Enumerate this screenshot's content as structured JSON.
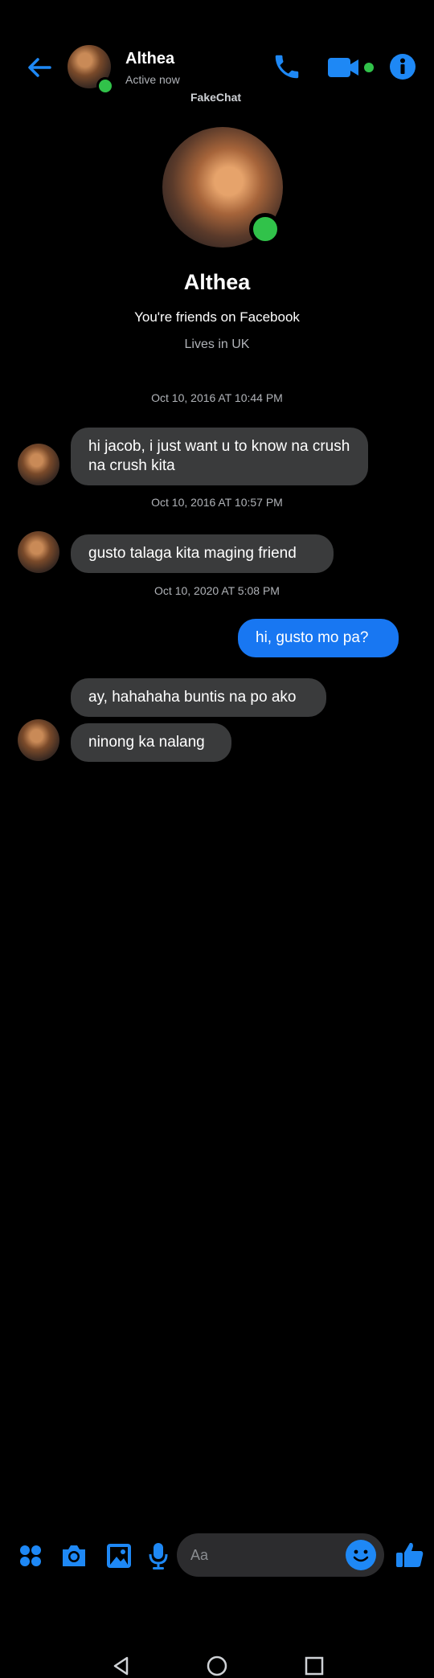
{
  "header": {
    "contact_name": "Althea",
    "status": "Active now",
    "watermark": "FakeChat"
  },
  "profile": {
    "name": "Althea",
    "friends_text": "You're friends on Facebook",
    "lives_text": "Lives in UK"
  },
  "messages": [
    {
      "type": "timestamp",
      "text": "Oct 10, 2016 AT 10:44 PM"
    },
    {
      "type": "incoming",
      "text": "hi jacob, i just want u to know na crush na crush kita"
    },
    {
      "type": "timestamp",
      "text": "Oct 10, 2016 AT 10:57 PM"
    },
    {
      "type": "incoming",
      "text": "gusto talaga kita maging friend"
    },
    {
      "type": "timestamp",
      "text": "Oct 10, 2020 AT 5:08 PM"
    },
    {
      "type": "outgoing",
      "text": "hi, gusto mo pa?"
    },
    {
      "type": "incoming",
      "text": "ay, hahahaha buntis na po ako"
    },
    {
      "type": "incoming",
      "text": "ninong ka nalang"
    }
  ],
  "composer": {
    "placeholder": "Aa"
  },
  "colors": {
    "accent": "#1e88f5",
    "online": "#31c24a",
    "bubble_incoming": "#3a3b3c",
    "bubble_outgoing": "#1877f2"
  },
  "icons": [
    "back-arrow-icon",
    "phone-icon",
    "video-icon",
    "info-icon",
    "apps-icon",
    "camera-icon",
    "gallery-icon",
    "mic-icon",
    "emoji-icon",
    "like-icon",
    "nav-back-icon",
    "nav-home-icon",
    "nav-recents-icon"
  ]
}
